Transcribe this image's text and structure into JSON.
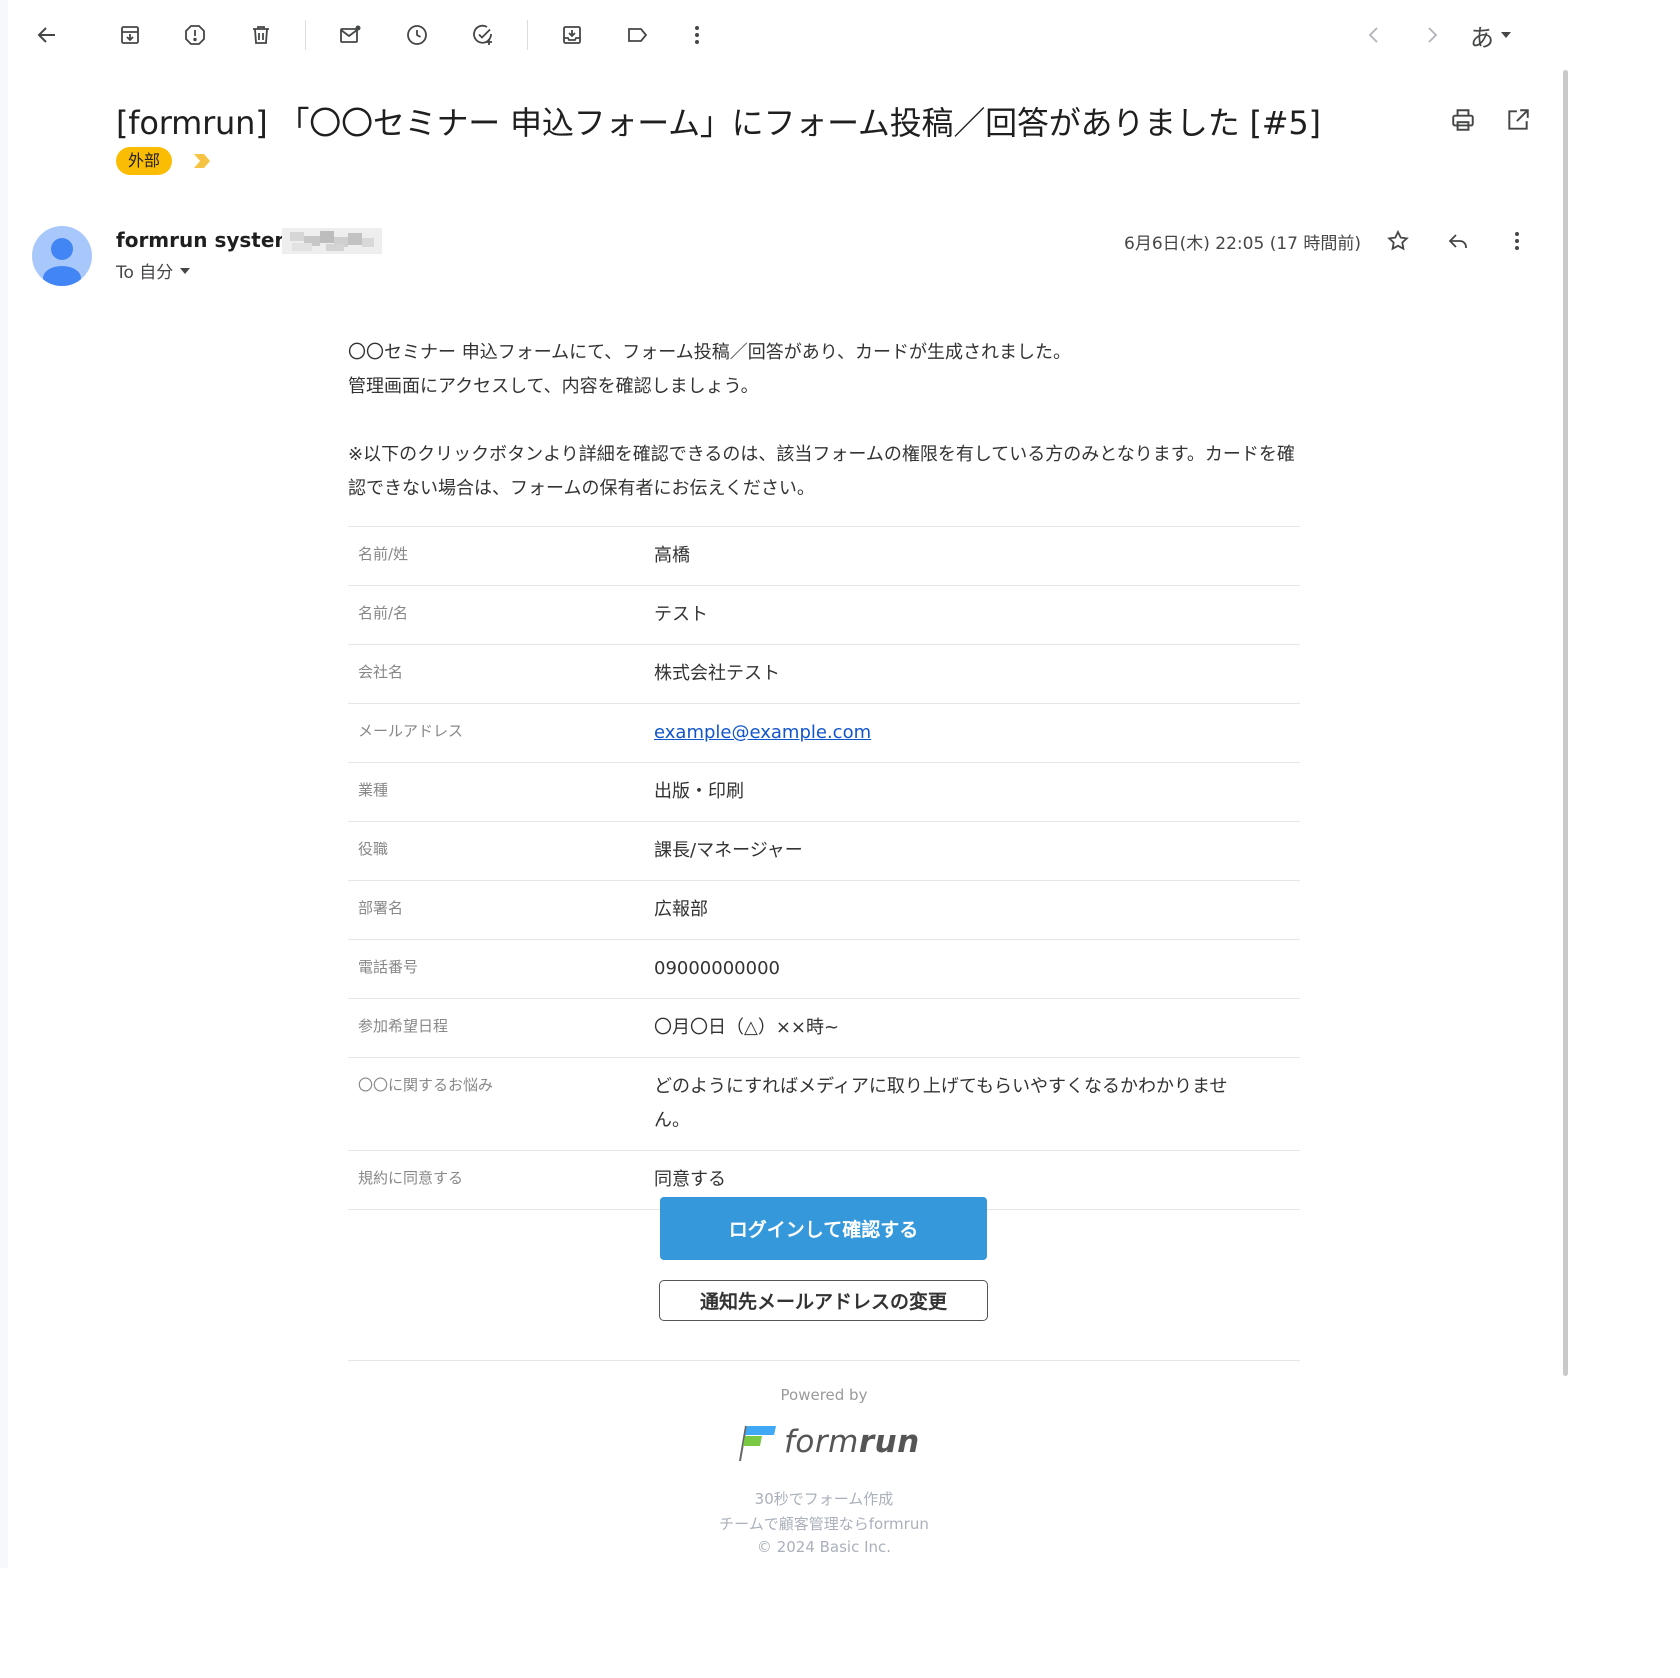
{
  "toolbar": {
    "icons": [
      "back-arrow-icon",
      "archive-icon",
      "report-spam-icon",
      "delete-icon",
      "mark-unread-icon",
      "snooze-icon",
      "add-to-tasks-icon",
      "move-to-icon",
      "label-icon",
      "more-vert-icon",
      "older-icon",
      "newer-icon"
    ],
    "ime_label": "あ"
  },
  "email": {
    "subject": "[formrun] 「〇〇セミナー 申込フォーム」にフォーム投稿／回答がありました [#5]",
    "label": "外部",
    "sender_name": "formrun system",
    "recipient": "To 自分",
    "date": "6月6日(木) 22:05 (17 時間前)"
  },
  "message": {
    "line1": "〇〇セミナー 申込フォームにて、フォーム投稿／回答があり、カードが生成されました。",
    "line2": "管理画面にアクセスして、内容を確認しましょう。",
    "notice": "※以下のクリックボタンより詳細を確認できるのは、該当フォームの権限を有している方のみとなります。カードを確認できない場合は、フォームの保有者にお伝えください。"
  },
  "fields": [
    {
      "label": "名前/姓",
      "value": "高橋"
    },
    {
      "label": "名前/名",
      "value": "テスト"
    },
    {
      "label": "会社名",
      "value": "株式会社テスト"
    },
    {
      "label": "メールアドレス",
      "value": "example@example.com"
    },
    {
      "label": "業種",
      "value": "出版・印刷"
    },
    {
      "label": "役職",
      "value": "課長/マネージャー"
    },
    {
      "label": "部署名",
      "value": "広報部"
    },
    {
      "label": "電話番号",
      "value": "09000000000"
    },
    {
      "label": "参加希望日程",
      "value": "〇月〇日（△）××時~"
    },
    {
      "label": "〇〇に関するお悩み",
      "value": "どのようにすればメディアに取り上げてもらいやすくなるかわかりません。"
    },
    {
      "label": "規約に同意する",
      "value": "同意する"
    }
  ],
  "buttons": {
    "login": "ログインして確認する",
    "change_email": "通知先メールアドレスの変更"
  },
  "footer": {
    "powered_by": "Powered by",
    "logo_text_a": "form",
    "logo_text_b": "run",
    "tagline1": "30秒でフォーム作成",
    "tagline2": "チームで顧客管理ならformrun",
    "copyright": "© 2024 Basic Inc."
  },
  "colors": {
    "label_chip": "#fbbc04",
    "primary_button": "#3498db",
    "link": "#1155cc",
    "avatar_bg": "#a8c7fa",
    "avatar_fg": "#4285f4"
  }
}
